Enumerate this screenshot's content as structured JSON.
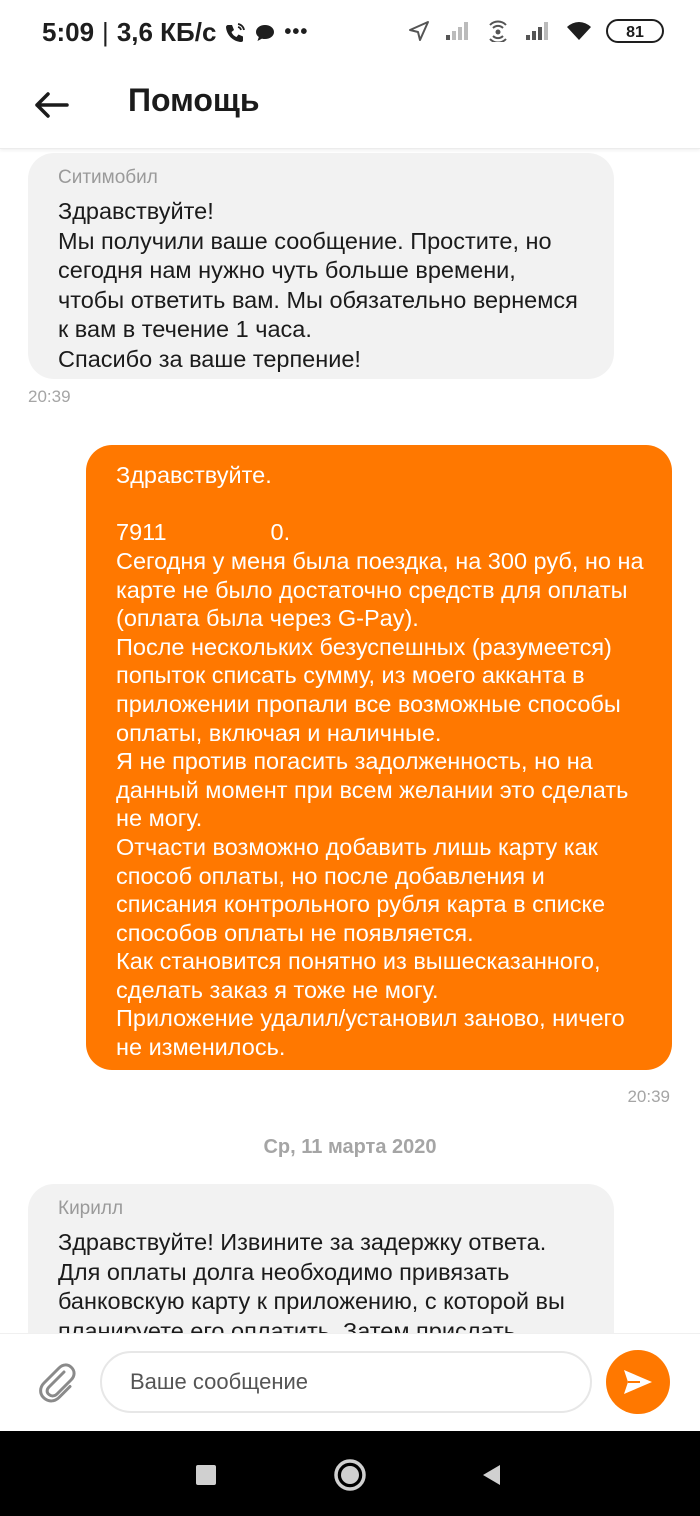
{
  "status_bar": {
    "time": "5:09",
    "separator": "|",
    "speed": "3,6 КБ/с",
    "more": "•••",
    "battery": "81"
  },
  "header": {
    "title": "Помощь"
  },
  "messages": [
    {
      "sender": "Ситимобил",
      "text": "Здравствуйте!\nМы получили ваше сообщение. Простите, но сегодня нам нужно чуть больше времени, чтобы ответить вам. Мы обязательно вернемся к вам в течение 1 часа.\nСпасибо за ваше терпение!",
      "time": "20:39"
    },
    {
      "line1": "Здравствуйте.",
      "line2_prefix": "7911",
      "line2_suffix": "0.",
      "text": "Сегодня у меня была поездка, на 300 руб, но на карте не было достаточно средств для оплаты (оплата была через G-Pay).\nПосле нескольких безуспешных (разумеется) попыток списать сумму, из моего акканта в приложении пропали все возможные способы оплаты, включая и наличные.\nЯ не против погасить задолженность, но на данный момент при всем желании это сделать не могу.\nОтчасти возможно добавить лишь карту как способ оплаты, но после добавления и списания контрольного рубля карта в списке способов оплаты не появляется.\nКак становится понятно из вышесказанного, сделать заказ я тоже не могу.\nПриложение удалил/установил заново, ничего не изменилось.",
      "time": "20:39"
    },
    {
      "sender": "Кирилл",
      "text": "Здравствуйте! Извините за задержку ответа. Для оплаты долга необходимо привязать банковскую карту к приложению, с которой вы планируете его оплатить. Затем прислать"
    }
  ],
  "date_separator": "Ср, 11 марта 2020",
  "composer": {
    "placeholder": "Ваше сообщение"
  },
  "colors": {
    "accent": "#ff7800",
    "incoming_bubble": "#f2f2f2"
  }
}
